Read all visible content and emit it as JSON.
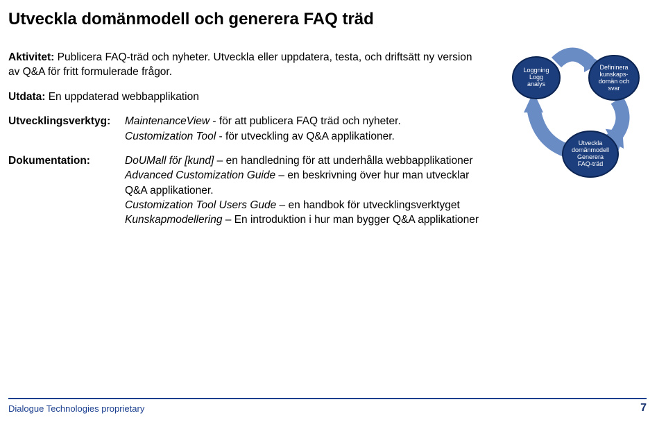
{
  "title": "Utveckla domänmodell och generera FAQ träd",
  "activity": {
    "label": "Aktivitet:",
    "text": " Publicera FAQ-träd och nyheter. Utveckla eller uppdatera, testa, och driftsätt ny version av Q&A för fritt formulerade frågor."
  },
  "output": {
    "label": "Utdata:",
    "text": " En uppdaterad webbapplikation"
  },
  "devtools": {
    "label": "Utvecklingsverktyg:",
    "line1": " - för att publicera FAQ träd och nyheter.",
    "tool1": "MaintenanceView",
    "tool2": "Customization Tool",
    "line2": " - för utveckling av Q&A applikationer."
  },
  "docs": {
    "label": "Dokumentation:",
    "doc1name": "DoUMall för [kund]",
    "doc1desc": " – en handledning för att underhålla webbapplikationer",
    "doc2name": "Advanced Customization Guide",
    "doc2desc": " – en beskrivning över hur man utvecklar Q&A applikationer.",
    "doc3name": "Customization Tool Users Gude",
    "doc3desc": " – en handbok för utvecklingsverktyget",
    "doc4name": "Kunskapmodellering",
    "doc4desc": " – En introduktion i hur man bygger Q&A applikationer"
  },
  "diagram": {
    "node1_l1": "Loggning",
    "node1_l2": "Logg",
    "node1_l3": "analys",
    "node2_l1": "Defininera",
    "node2_l2": "kunskaps-",
    "node2_l3": "domän och",
    "node2_l4": "svar",
    "node3_l1": "Utveckla",
    "node3_l2": "domänmodell",
    "node3_l3": "Generera",
    "node3_l4": "FAQ-träd"
  },
  "footer": {
    "left": "Dialogue Technologies proprietary",
    "right": "7"
  },
  "colors": {
    "arrow": "#6a8cc5",
    "node_fill": "#1c3e7d",
    "node_stroke": "#0b2452",
    "footer": "#1b3f8f"
  }
}
